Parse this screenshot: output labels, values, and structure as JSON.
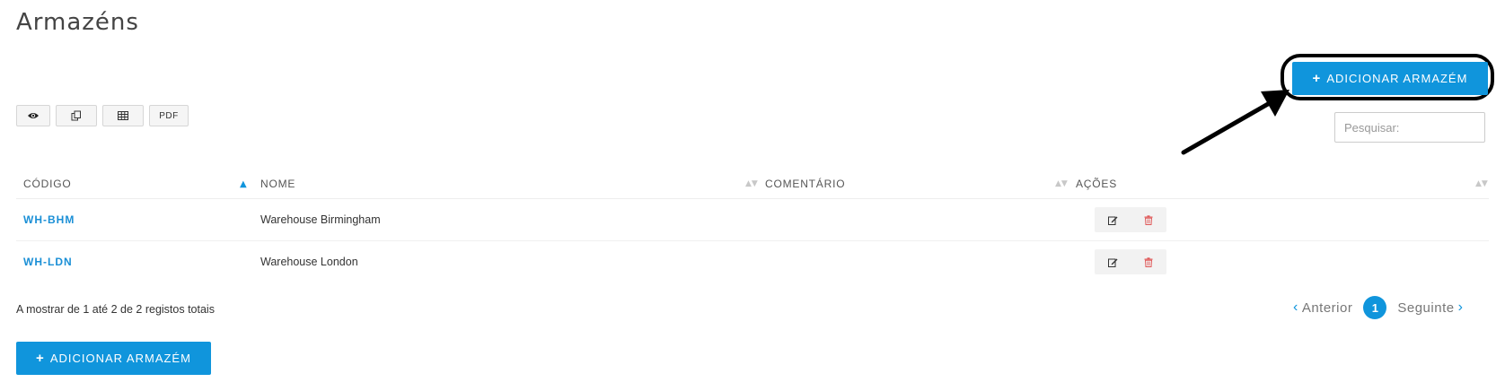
{
  "page": {
    "title": "Armazéns"
  },
  "add_button": {
    "label": "ADICIONAR ARMAZÉM"
  },
  "toolbar": {
    "buttons": [
      {
        "icon": "eye-icon",
        "label": ""
      },
      {
        "icon": "copy-icon",
        "label": ""
      },
      {
        "icon": "csv-table-icon",
        "label": ""
      },
      {
        "icon": "pdf-icon",
        "label": "PDF"
      }
    ]
  },
  "search": {
    "placeholder": "Pesquisar:",
    "value": ""
  },
  "table": {
    "columns": [
      {
        "label": "CÓDIGO",
        "sort": "asc"
      },
      {
        "label": "NOME",
        "sort": "none"
      },
      {
        "label": "COMENTÁRIO",
        "sort": "none"
      },
      {
        "label": "AÇÕES",
        "sort": "none"
      }
    ],
    "rows": [
      {
        "code": "WH-BHM",
        "name": "Warehouse Birmingham",
        "comment": ""
      },
      {
        "code": "WH-LDN",
        "name": "Warehouse London",
        "comment": ""
      }
    ]
  },
  "info": {
    "text": "A mostrar de 1 até 2 de 2 registos totais"
  },
  "pagination": {
    "previous": "Anterior",
    "next": "Seguinte",
    "current": "1"
  },
  "colors": {
    "primary": "#1095dc",
    "link": "#1a8fd6",
    "delete": "#e05a5a",
    "annotation": "#000000"
  }
}
